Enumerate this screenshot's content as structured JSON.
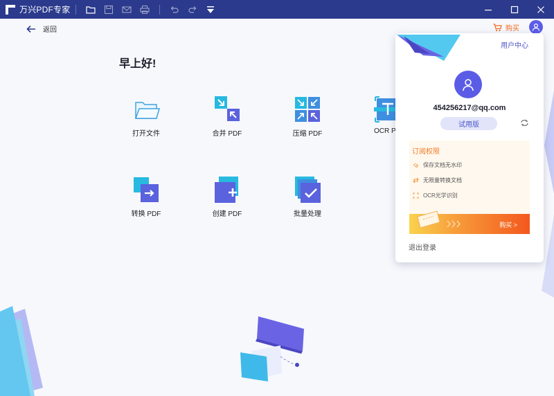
{
  "app": {
    "title": "万兴PDF专家"
  },
  "toolbar": {
    "icons": [
      "open-folder-icon",
      "save-icon",
      "mail-icon",
      "print-icon",
      "undo-icon",
      "redo-icon",
      "quick-access-icon"
    ]
  },
  "window_controls": [
    "minimize-icon",
    "maximize-icon",
    "close-icon"
  ],
  "nav": {
    "back_label": "返回"
  },
  "header": {
    "buy_label": "购买"
  },
  "greeting": "早上好!",
  "tools": [
    {
      "label": "打开文件",
      "icon": "open-file-icon"
    },
    {
      "label": "合并 PDF",
      "icon": "merge-pdf-icon"
    },
    {
      "label": "压缩 PDF",
      "icon": "compress-pdf-icon"
    },
    {
      "label": "OCR PDF",
      "icon": "ocr-pdf-icon"
    },
    {
      "label": "转换 PDF",
      "icon": "convert-pdf-icon"
    },
    {
      "label": "创建 PDF",
      "icon": "create-pdf-icon"
    },
    {
      "label": "批量处理",
      "icon": "batch-process-icon"
    }
  ],
  "account_popup": {
    "user_center_label": "用户中心",
    "email": "454256217@qq.com",
    "plan_badge": "试用版",
    "subscription_title": "订阅权限",
    "permissions": [
      {
        "label": "保存文档无水印",
        "icon": "watermark-icon"
      },
      {
        "label": "无限量转换文档",
        "icon": "convert-arrows-icon"
      },
      {
        "label": "OCR光学识别",
        "icon": "scan-icon"
      }
    ],
    "buy_button_label": "购买 >",
    "logout_label": "退出登录"
  },
  "colors": {
    "titlebar": "#2b3a8c",
    "accent": "#5b5ce6",
    "buy": "#f26b1d"
  }
}
